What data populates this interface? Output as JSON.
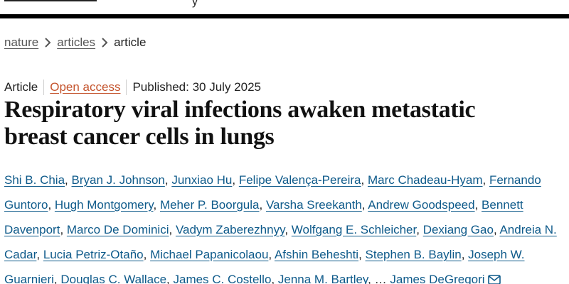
{
  "header": {
    "partial_text": "y"
  },
  "breadcrumb": {
    "items": [
      {
        "label": "nature"
      },
      {
        "label": "articles"
      }
    ],
    "current": "article"
  },
  "meta": {
    "type": "Article",
    "access": "Open access",
    "published": "Published: 30 July 2025"
  },
  "title": {
    "line1": "Respiratory viral infections awaken metastatic",
    "line2": "breast cancer cells in lungs"
  },
  "authors": {
    "list": [
      "Shi B. Chia",
      "Bryan J. Johnson",
      "Junxiao Hu",
      "Felipe Valença-Pereira",
      "Marc Chadeau-Hyam",
      "Fernando Guntoro",
      "Hugh Montgomery",
      "Meher P. Boorgula",
      "Varsha Sreekanth",
      "Andrew Goodspeed",
      "Bennett Davenport",
      "Marco De Dominici",
      "Vadym Zaberezhnyy",
      "Wolfgang E. Schleicher",
      "Dexiang Gao",
      "Andreia N. Cadar",
      "Lucia Petriz-Otaño",
      "Michael Papanicolaou",
      "Afshin Beheshti",
      "Stephen B. Baylin",
      "Joseph W. Guarnieri",
      "Douglas C. Wallace",
      "James C. Costello",
      "Jenna M. Bartley"
    ],
    "ellipsis": "…",
    "last": "James DeGregori"
  },
  "icons": {
    "chevron": "chevron-right-icon",
    "mail": "mail-icon"
  },
  "colors": {
    "link": "#0e5a8a",
    "open_access": "#c4532c",
    "top_bar": "#000000"
  }
}
